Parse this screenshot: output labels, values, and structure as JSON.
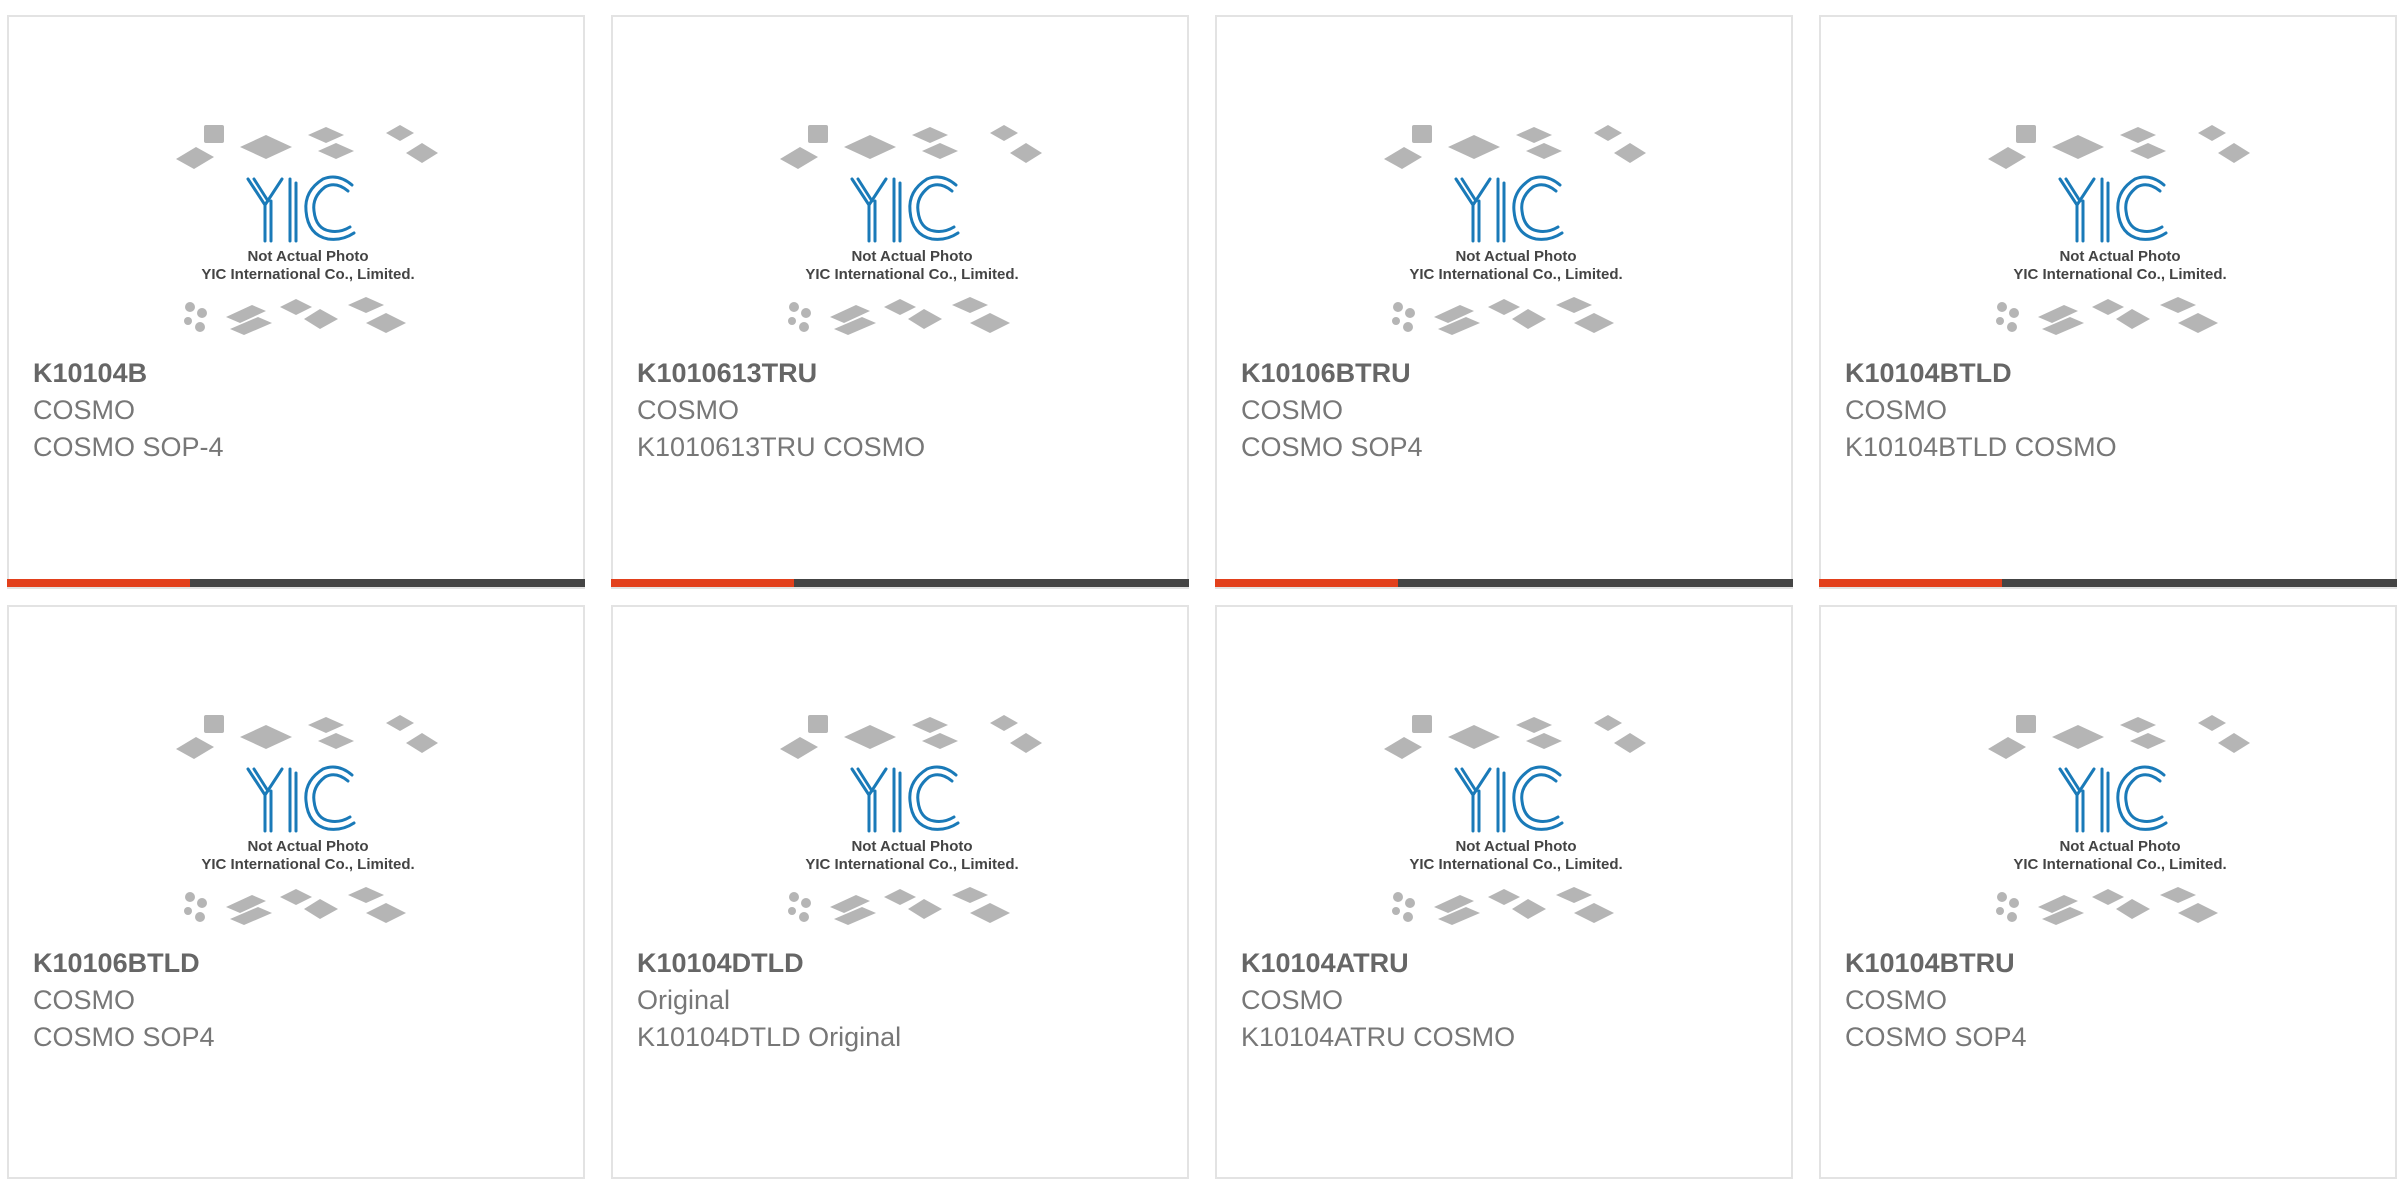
{
  "products": [
    {
      "part": "K10104B",
      "brand": "COSMO",
      "description": "COSMO SOP-4",
      "image_caption": "Not Actual Photo",
      "image_company": "YIC International Co., Limited.",
      "logo_text": "YIC"
    },
    {
      "part": "K1010613TRU",
      "brand": "COSMO",
      "description": "K1010613TRU COSMO",
      "image_caption": "Not Actual Photo",
      "image_company": "YIC International Co., Limited.",
      "logo_text": "YIC"
    },
    {
      "part": "K10106BTRU",
      "brand": "COSMO",
      "description": "COSMO SOP4",
      "image_caption": "Not Actual Photo",
      "image_company": "YIC International Co., Limited.",
      "logo_text": "YIC"
    },
    {
      "part": "K10104BTLD",
      "brand": "COSMO",
      "description": "K10104BTLD COSMO",
      "image_caption": "Not Actual Photo",
      "image_company": "YIC International Co., Limited.",
      "logo_text": "YIC"
    },
    {
      "part": "K10106BTLD",
      "brand": "COSMO",
      "description": "COSMO SOP4",
      "image_caption": "Not Actual Photo",
      "image_company": "YIC International Co., Limited.",
      "logo_text": "YIC"
    },
    {
      "part": "K10104DTLD",
      "brand": "Original",
      "description": "K10104DTLD Original",
      "image_caption": "Not Actual Photo",
      "image_company": "YIC International Co., Limited.",
      "logo_text": "YIC"
    },
    {
      "part": "K10104ATRU",
      "brand": "COSMO",
      "description": "K10104ATRU COSMO",
      "image_caption": "Not Actual Photo",
      "image_company": "YIC International Co., Limited.",
      "logo_text": "YIC"
    },
    {
      "part": "K10104BTRU",
      "brand": "COSMO",
      "description": "COSMO SOP4",
      "image_caption": "Not Actual Photo",
      "image_company": "YIC International Co., Limited.",
      "logo_text": "YIC"
    }
  ],
  "colors": {
    "accent": "#e2401c",
    "bar": "#444444",
    "logo": "#1a7ab8",
    "chip": "#b5b5b5"
  }
}
